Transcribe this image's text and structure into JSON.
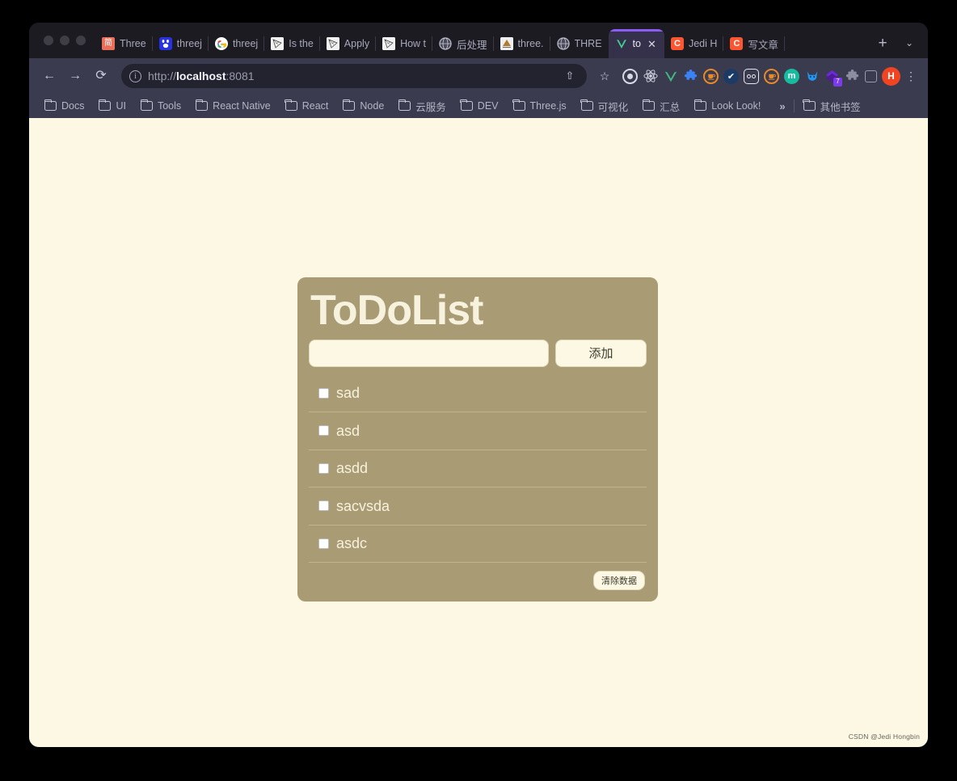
{
  "browser": {
    "traffic_lights": [
      "close",
      "minimize",
      "maximize"
    ],
    "tabs": [
      {
        "favicon": "jianshu-icon",
        "fav_glyph": "简",
        "fav_class": "fav-jianshu",
        "label": "Three",
        "active": false
      },
      {
        "favicon": "baidu-icon",
        "fav_glyph": "熊",
        "fav_class": "fav-baidu",
        "label": "threej",
        "active": false
      },
      {
        "favicon": "google-icon",
        "fav_glyph": "G",
        "fav_class": "fav-google",
        "label": "threej",
        "active": false
      },
      {
        "favicon": "threejs-doc-icon",
        "fav_glyph": "◣",
        "fav_class": "fav-three",
        "label": "Is the",
        "active": false
      },
      {
        "favicon": "threejs-doc-icon",
        "fav_glyph": "◣",
        "fav_class": "fav-three",
        "label": "Apply",
        "active": false
      },
      {
        "favicon": "threejs-doc-icon",
        "fav_glyph": "◣",
        "fav_class": "fav-three",
        "label": "How t",
        "active": false
      },
      {
        "favicon": "globe-icon",
        "fav_glyph": "✇",
        "fav_class": "fav-globe",
        "label": "后处理",
        "active": false
      },
      {
        "favicon": "book-icon",
        "fav_glyph": "▤",
        "fav_class": "fav-doc",
        "label": "three.",
        "active": false
      },
      {
        "favicon": "globe-icon",
        "fav_glyph": "✇",
        "fav_class": "fav-globe",
        "label": "THRE",
        "active": false
      },
      {
        "favicon": "vite-icon",
        "fav_glyph": "V",
        "fav_class": "fav-vite",
        "label": "to",
        "active": true
      },
      {
        "favicon": "csdn-icon",
        "fav_glyph": "C",
        "fav_class": "fav-csdn",
        "label": "Jedi H",
        "active": false
      },
      {
        "favicon": "csdn-icon",
        "fav_glyph": "C",
        "fav_class": "fav-csdn",
        "label": "写文章",
        "active": false
      }
    ],
    "new_tab_label": "+",
    "tab_list_label": "⌄",
    "nav": {
      "back": "←",
      "forward": "→",
      "reload": "⟳"
    },
    "url": {
      "info_glyph": "i",
      "prefix": "http://",
      "host": "localhost",
      "suffix": ":8081",
      "share_glyph": "⇧",
      "star_glyph": "☆"
    },
    "extensions": [
      {
        "name": "target-icon",
        "class": "ext-target",
        "glyph": ""
      },
      {
        "name": "react-devtools-icon",
        "class": "ext-react",
        "glyph": "⚛"
      },
      {
        "name": "vue-devtools-icon",
        "class": "ext-vue",
        "glyph": "V"
      },
      {
        "name": "puzzle-blue-icon",
        "class": "ext-puzzle-blue",
        "glyph": "🧩"
      },
      {
        "name": "coffee-orange-icon",
        "class": "ext-coffee",
        "glyph": "☕"
      },
      {
        "name": "check-circle-icon",
        "class": "ext-check",
        "glyph": "✔"
      },
      {
        "name": "goggles-icon",
        "class": "ext-goggles",
        "glyph": ""
      },
      {
        "name": "coffee-orange-icon",
        "class": "ext-coffee",
        "glyph": "☕"
      },
      {
        "name": "momentum-icon",
        "class": "ext-m",
        "glyph": "m"
      },
      {
        "name": "cat-icon",
        "class": "ext-cat",
        "glyph": "🐱"
      },
      {
        "name": "diamond-icon",
        "class": "ext-diamond",
        "glyph": "",
        "badge": "7"
      },
      {
        "name": "extensions-puzzle-icon",
        "class": "ext-puzzle-gray",
        "glyph": "🧩"
      },
      {
        "name": "side-panel-icon",
        "class": "ext-panel",
        "glyph": ""
      }
    ],
    "profile_initial": "H",
    "menu_glyph": "⋮",
    "bookmarks": [
      {
        "label": "Docs"
      },
      {
        "label": "UI"
      },
      {
        "label": "Tools"
      },
      {
        "label": "React Native"
      },
      {
        "label": "React"
      },
      {
        "label": "Node"
      },
      {
        "label": "云服务"
      },
      {
        "label": "DEV"
      },
      {
        "label": "Three.js"
      },
      {
        "label": "可视化"
      },
      {
        "label": "汇总"
      },
      {
        "label": "Look Look!"
      }
    ],
    "bookmarks_overflow": "»",
    "other_bookmarks_label": "其他书签"
  },
  "app": {
    "title": "ToDoList",
    "input_value": "",
    "input_placeholder": "",
    "add_button_label": "添加",
    "clear_button_label": "清除数据",
    "items": [
      {
        "label": "sad",
        "checked": false
      },
      {
        "label": "asd",
        "checked": false
      },
      {
        "label": "asdd",
        "checked": false
      },
      {
        "label": "sacvsda",
        "checked": false
      },
      {
        "label": "asdc",
        "checked": false
      }
    ],
    "colors": {
      "page_background": "#fdf8e3",
      "card_background": "#a99b74",
      "card_text": "#f7f2dd",
      "field_background": "#fcf8e3",
      "separator": "#c0b58e"
    }
  },
  "watermark": "CSDN @Jedi Hongbin"
}
